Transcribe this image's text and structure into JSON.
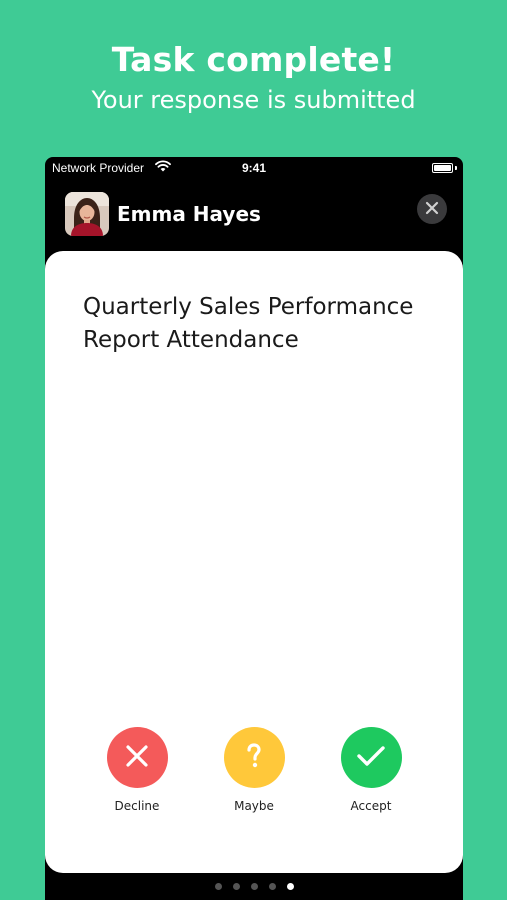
{
  "promo": {
    "headline": "Task complete!",
    "subline": "Your response is submitted"
  },
  "status_bar": {
    "carrier": "Network Provider",
    "time": "9:41",
    "wifi_icon": "wifi-icon",
    "battery_icon": "battery-icon"
  },
  "header": {
    "user_name": "Emma Hayes",
    "avatar_icon": "avatar",
    "close_icon": "close-icon"
  },
  "card": {
    "title": "Quarterly Sales Performance Report Attendance"
  },
  "actions": [
    {
      "label": "Decline",
      "icon": "x-icon",
      "color": "#f45a5a"
    },
    {
      "label": "Maybe",
      "icon": "question-icon",
      "color": "#ffc83a"
    },
    {
      "label": "Accept",
      "icon": "check-icon",
      "color": "#1ec95f"
    }
  ],
  "pagination": {
    "count": 5,
    "active_index": 4
  },
  "colors": {
    "background": "#3fcb95",
    "phone": "#000000",
    "card": "#ffffff"
  }
}
